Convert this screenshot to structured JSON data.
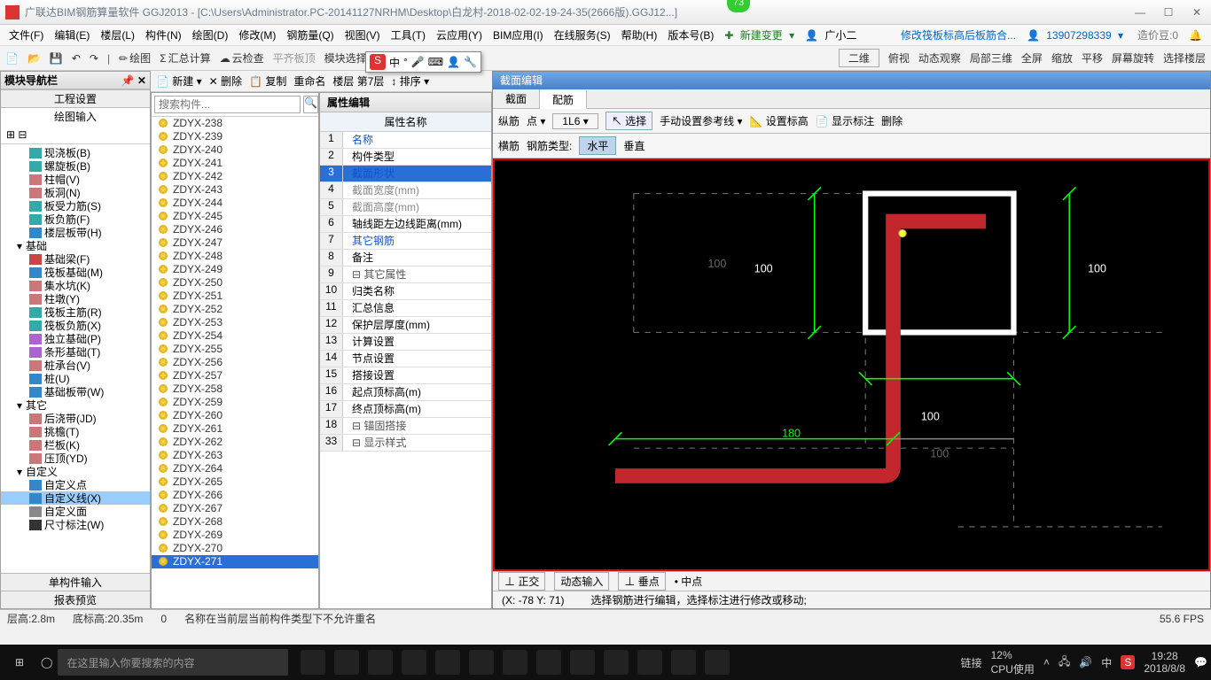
{
  "titlebar": {
    "title": "广联达BIM钢筋算量软件 GGJ2013 - [C:\\Users\\Administrator.PC-20141127NRHM\\Desktop\\白龙村-2018-02-02-19-24-35(2666版).GGJ12...]",
    "badge": "73"
  },
  "menubar": {
    "items": [
      "文件(F)",
      "编辑(E)",
      "楼层(L)",
      "构件(N)",
      "绘图(D)",
      "修改(M)",
      "钢筋量(Q)",
      "视图(V)",
      "工具(T)",
      "云应用(Y)",
      "BIM应用(I)",
      "在线服务(S)",
      "帮助(H)",
      "版本号(B)"
    ],
    "newChange": "新建变更",
    "rightUser": "广小二",
    "rightLink": "修改筏板标高后板筋合...",
    "phone": "13907298339",
    "price": "造价豆:0"
  },
  "toolbar1": {
    "items": [
      "绘图",
      "汇总计算",
      "云检查",
      "平齐板顶",
      "",
      "",
      "模块导航栏",
      "",
      "模块选择"
    ],
    "right": [
      "二维",
      "俯视",
      "动态观察",
      "局部三维",
      "全屏",
      "缩放",
      "平移",
      "屏幕旋转",
      "选择楼层"
    ]
  },
  "leftPanel": {
    "title": "模块导航栏",
    "tabs": [
      "工程设置",
      "绘图输入"
    ],
    "groups": [
      {
        "indent": 2,
        "icon": "#3aa",
        "label": "现浇板(B)"
      },
      {
        "indent": 2,
        "icon": "#3aa",
        "label": "螺旋板(B)"
      },
      {
        "indent": 2,
        "icon": "#c77",
        "label": "柱帽(V)"
      },
      {
        "indent": 2,
        "icon": "#c77",
        "label": "板洞(N)"
      },
      {
        "indent": 2,
        "icon": "#3aa",
        "label": "板受力筋(S)"
      },
      {
        "indent": 2,
        "icon": "#3aa",
        "label": "板负筋(F)"
      },
      {
        "indent": 2,
        "icon": "#38c",
        "label": "楼层板带(H)"
      },
      {
        "indent": 1,
        "icon": "",
        "label": "基础",
        "group": true
      },
      {
        "indent": 2,
        "icon": "#c44",
        "label": "基础梁(F)"
      },
      {
        "indent": 2,
        "icon": "#38c",
        "label": "筏板基础(M)"
      },
      {
        "indent": 2,
        "icon": "#c77",
        "label": "集水坑(K)"
      },
      {
        "indent": 2,
        "icon": "#c77",
        "label": "柱墩(Y)"
      },
      {
        "indent": 2,
        "icon": "#3aa",
        "label": "筏板主筋(R)"
      },
      {
        "indent": 2,
        "icon": "#3aa",
        "label": "筏板负筋(X)"
      },
      {
        "indent": 2,
        "icon": "#a6c",
        "label": "独立基础(P)"
      },
      {
        "indent": 2,
        "icon": "#a6c",
        "label": "条形基础(T)"
      },
      {
        "indent": 2,
        "icon": "#c77",
        "label": "桩承台(V)"
      },
      {
        "indent": 2,
        "icon": "#38c",
        "label": "桩(U)"
      },
      {
        "indent": 2,
        "icon": "#38c",
        "label": "基础板带(W)"
      },
      {
        "indent": 1,
        "icon": "",
        "label": "其它",
        "group": true
      },
      {
        "indent": 2,
        "icon": "#c77",
        "label": "后浇带(JD)"
      },
      {
        "indent": 2,
        "icon": "#c77",
        "label": "挑檐(T)"
      },
      {
        "indent": 2,
        "icon": "#c77",
        "label": "栏板(K)"
      },
      {
        "indent": 2,
        "icon": "#c77",
        "label": "压顶(YD)"
      },
      {
        "indent": 1,
        "icon": "",
        "label": "自定义",
        "group": true
      },
      {
        "indent": 2,
        "icon": "#38c",
        "label": "自定义点"
      },
      {
        "indent": 2,
        "icon": "#38c",
        "label": "自定义线(X)",
        "hl": true
      },
      {
        "indent": 2,
        "icon": "#888",
        "label": "自定义面"
      },
      {
        "indent": 2,
        "icon": "#333",
        "label": "尺寸标注(W)"
      }
    ],
    "bottom1": "单构件输入",
    "bottom2": "报表预览"
  },
  "midToolbar": {
    "items": [
      "新建",
      "删除",
      "复制",
      "重命名",
      "楼层 第7层",
      "排序"
    ]
  },
  "componentList": {
    "searchPlaceholder": "搜索构件...",
    "items": [
      "ZDYX-238",
      "ZDYX-239",
      "ZDYX-240",
      "ZDYX-241",
      "ZDYX-242",
      "ZDYX-243",
      "ZDYX-244",
      "ZDYX-245",
      "ZDYX-246",
      "ZDYX-247",
      "ZDYX-248",
      "ZDYX-249",
      "ZDYX-250",
      "ZDYX-251",
      "ZDYX-252",
      "ZDYX-253",
      "ZDYX-254",
      "ZDYX-255",
      "ZDYX-256",
      "ZDYX-257",
      "ZDYX-258",
      "ZDYX-259",
      "ZDYX-260",
      "ZDYX-261",
      "ZDYX-262",
      "ZDYX-263",
      "ZDYX-264",
      "ZDYX-265",
      "ZDYX-266",
      "ZDYX-267",
      "ZDYX-268",
      "ZDYX-269",
      "ZDYX-270",
      "ZDYX-271"
    ],
    "selected": "ZDYX-271"
  },
  "propPanel": {
    "title": "属性编辑",
    "header": "属性名称",
    "rows": [
      {
        "n": "1",
        "label": "名称",
        "cls": "link"
      },
      {
        "n": "2",
        "label": "构件类型"
      },
      {
        "n": "3",
        "label": "截面形状",
        "cls": "link",
        "sel": true
      },
      {
        "n": "4",
        "label": "截面宽度(mm)",
        "cls": "gray"
      },
      {
        "n": "5",
        "label": "截面高度(mm)",
        "cls": "gray"
      },
      {
        "n": "6",
        "label": "轴线距左边线距离(mm)"
      },
      {
        "n": "7",
        "label": "其它钢筋",
        "cls": "link"
      },
      {
        "n": "8",
        "label": "备注"
      },
      {
        "n": "9",
        "label": "其它属性",
        "grp": true
      },
      {
        "n": "10",
        "label": "归类名称"
      },
      {
        "n": "11",
        "label": "汇总信息"
      },
      {
        "n": "12",
        "label": "保护层厚度(mm)"
      },
      {
        "n": "13",
        "label": "计算设置"
      },
      {
        "n": "14",
        "label": "节点设置"
      },
      {
        "n": "15",
        "label": "搭接设置"
      },
      {
        "n": "16",
        "label": "起点顶标高(m)"
      },
      {
        "n": "17",
        "label": "终点顶标高(m)"
      },
      {
        "n": "18",
        "label": "锚固搭接",
        "grp": true
      },
      {
        "n": "33",
        "label": "显示样式",
        "grp": true
      }
    ]
  },
  "canvas": {
    "title": "截面编辑",
    "tabs": [
      "截面",
      "配筋"
    ],
    "bar1": {
      "zong": "纵筋",
      "dian": "点",
      "select": "1L6",
      "selBtn": "选择",
      "manual": "手动设置参考线",
      "setElev": "设置标高",
      "showAnno": "显示标注",
      "del": "删除"
    },
    "bar2": {
      "heng": "横筋",
      "type": "钢筋类型:",
      "h": "水平",
      "v": "垂直"
    },
    "dims": {
      "d100a": "100",
      "d100b": "100",
      "d100c": "100",
      "d180": "180",
      "d100d": "100",
      "d100e": "100"
    },
    "statusBtns": [
      "正交",
      "动态输入",
      "垂点",
      "中点"
    ],
    "coord": "(X: -78 Y: 71)",
    "hint": "选择钢筋进行编辑，选择标注进行修改或移动;"
  },
  "statusbar": {
    "left1": "层高:2.8m",
    "left2": "底标高:20.35m",
    "left3": "0",
    "mid": "名称在当前层当前构件类型下不允许重名",
    "right": "55.6 FPS"
  },
  "taskbar": {
    "searchPlaceholder": "在这里输入你要搜索的内容",
    "link": "链接",
    "cpu1": "12%",
    "cpu2": "CPU使用",
    "ime": "中",
    "time": "19:28",
    "date": "2018/8/8"
  },
  "ime": {
    "s": "S",
    "zhong": "中"
  }
}
